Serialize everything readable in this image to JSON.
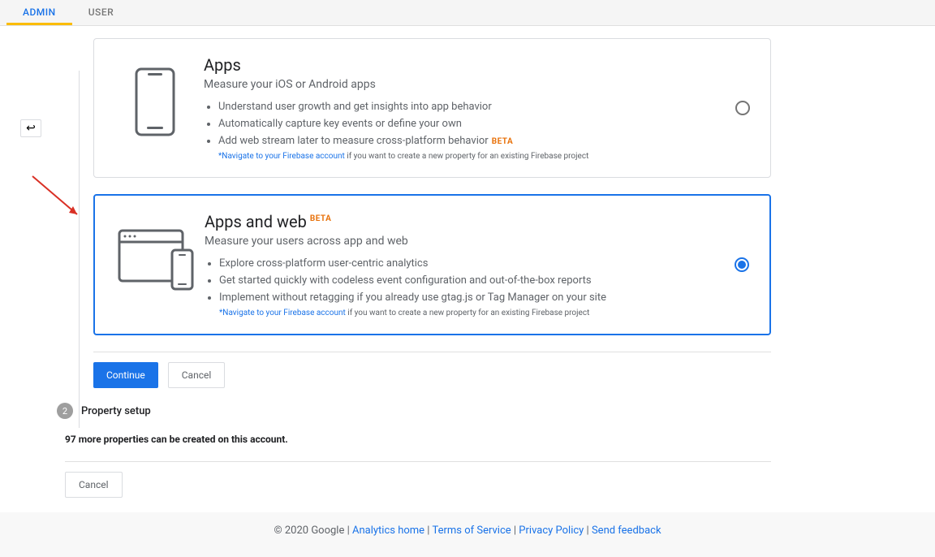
{
  "tabs": {
    "admin": "ADMIN",
    "user": "USER"
  },
  "cards": {
    "apps": {
      "title": "Apps",
      "subtitle": "Measure your iOS or Android apps",
      "bullets": [
        "Understand user growth and get insights into app behavior",
        "Automatically capture key events or define your own",
        "Add web stream later to measure cross-platform behavior"
      ],
      "beta_suffix": "BETA",
      "firebase_link": "*Navigate to your Firebase account",
      "firebase_rest": " if you want to create a new property for an existing Firebase project"
    },
    "apps_web": {
      "title": "Apps and web",
      "beta": "BETA",
      "subtitle": "Measure your users across app and web",
      "bullets": [
        "Explore cross-platform user-centric analytics",
        "Get started quickly with codeless event configuration and out-of-the-box reports",
        "Implement without retagging if you already use gtag.js or Tag Manager on your site"
      ],
      "firebase_link": "*Navigate to your Firebase account",
      "firebase_rest": " if you want to create a new property for an existing Firebase project"
    }
  },
  "buttons": {
    "continue": "Continue",
    "cancel": "Cancel"
  },
  "step2": {
    "num": "2",
    "label": "Property setup"
  },
  "limit_note": "97 more properties can be created on this account.",
  "footer": {
    "copyright": "© 2020 Google | ",
    "home": "Analytics home",
    "tos": "Terms of Service",
    "privacy": "Privacy Policy",
    "feedback": "Send feedback"
  }
}
